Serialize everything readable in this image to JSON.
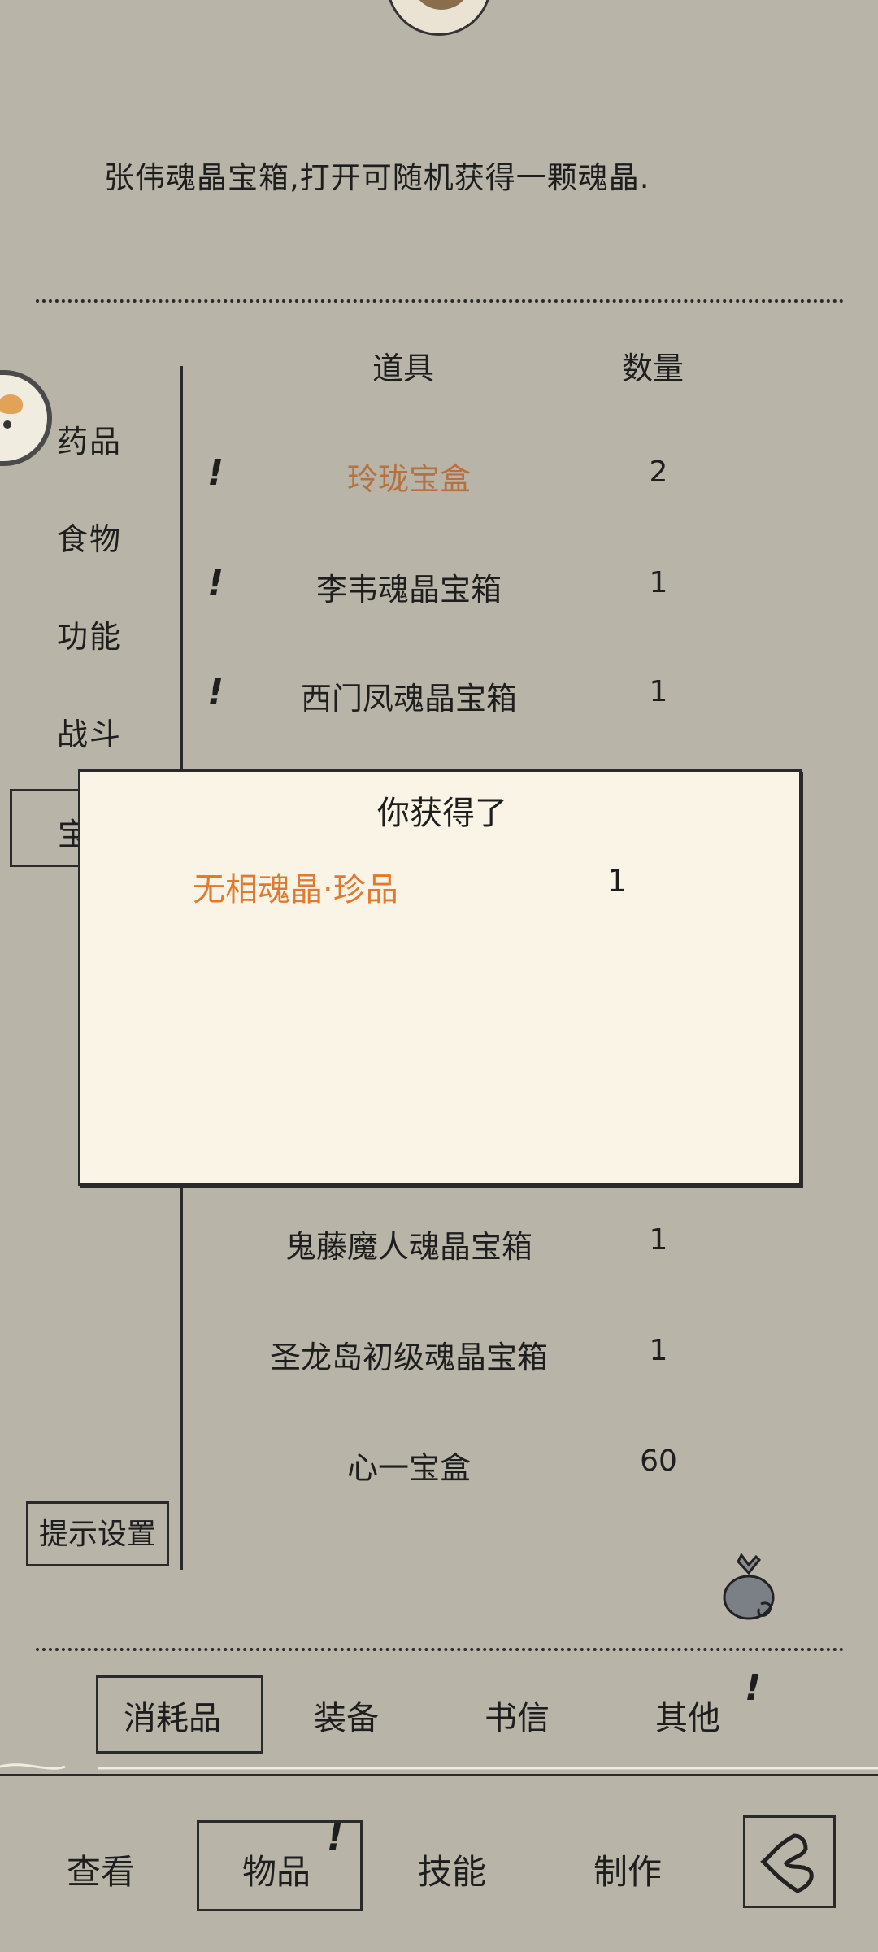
{
  "description": "张伟魂晶宝箱,打开可随机获得一颗魂晶.",
  "categories": [
    "药品",
    "食物",
    "功能",
    "战斗",
    "宝"
  ],
  "table": {
    "headers": {
      "item": "道具",
      "qty": "数量"
    },
    "rows": [
      {
        "name": "玲珑宝盒",
        "qty": "2",
        "alert": "!",
        "highlight": true
      },
      {
        "name": "李韦魂晶宝箱",
        "qty": "1",
        "alert": "!"
      },
      {
        "name": "西门凤魂晶宝箱",
        "qty": "1",
        "alert": "!"
      },
      {
        "name": "鬼藤魔人魂晶宝箱",
        "qty": "1"
      },
      {
        "name": "圣龙岛初级魂晶宝箱",
        "qty": "1"
      },
      {
        "name": "心一宝盒",
        "qty": "60"
      }
    ]
  },
  "hint_button": "提示设置",
  "tabs": [
    "消耗品",
    "装备",
    "书信",
    "其他"
  ],
  "tab_alert": "!",
  "nav": [
    "查看",
    "物品",
    "技能",
    "制作"
  ],
  "nav_alert": "!",
  "popup": {
    "title": "你获得了",
    "item": "无相魂晶·珍品",
    "qty": "1"
  },
  "colors": {
    "background": "#b8b4a8",
    "highlight_item": "#b5713f",
    "popup_item": "#e07a30",
    "popup_bg": "#f9f4e6"
  }
}
